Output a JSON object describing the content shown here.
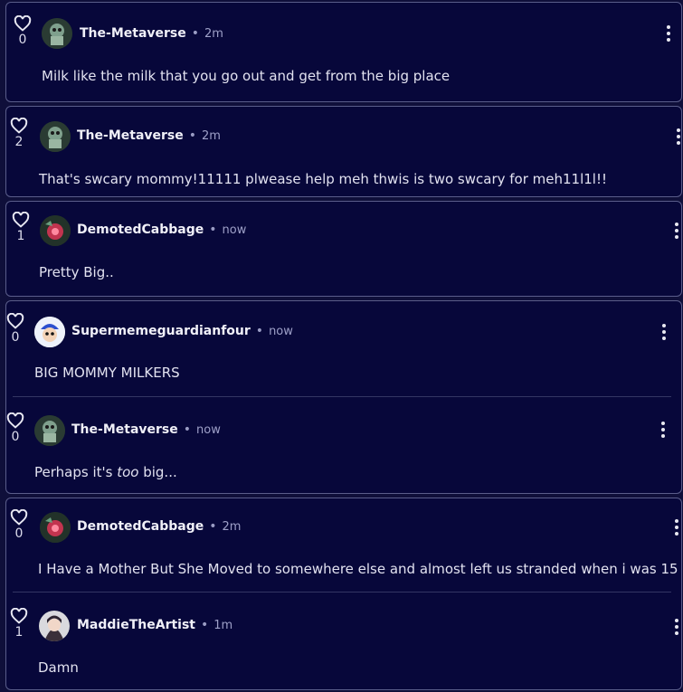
{
  "comments": [
    {
      "user": "The-Metaverse",
      "time": "2m",
      "likes": "0",
      "text": "Milk like the milk that you go out and get from the big place",
      "avatar": "cyborg-avatar"
    },
    {
      "user": "The-Metaverse",
      "time": "2m",
      "likes": "2",
      "text": "That's swcary mommy!11111 plwease help meh thwis is two swcary for meh11l1l!!",
      "avatar": "cyborg-avatar"
    },
    {
      "user": "DemotedCabbage",
      "time": "now",
      "likes": "1",
      "text": "Pretty Big..",
      "avatar": "cabbage-avatar"
    },
    {
      "user": "Supermemeguardianfour",
      "time": "now",
      "likes": "0",
      "text": "BIG MOMMY MILKERS",
      "avatar": "smg4-avatar"
    },
    {
      "user": "The-Metaverse",
      "time": "now",
      "likes": "0",
      "text_pre": "Perhaps it's ",
      "text_em": "too",
      "text_post": " big...",
      "avatar": "cyborg-avatar"
    },
    {
      "user": "DemotedCabbage",
      "time": "2m",
      "likes": "0",
      "text": "I Have a Mother But She Moved to somewhere else and almost left us stranded when i was 15",
      "avatar": "cabbage-avatar"
    },
    {
      "user": "MaddieTheArtist",
      "time": "1m",
      "likes": "1",
      "text": "Damn",
      "avatar": "artist-avatar"
    }
  ],
  "separator": "•",
  "colors": {
    "background": "#0f0f3a",
    "card": "#07073a",
    "border": "#5a5d8a",
    "text": "#e8e8f2"
  }
}
